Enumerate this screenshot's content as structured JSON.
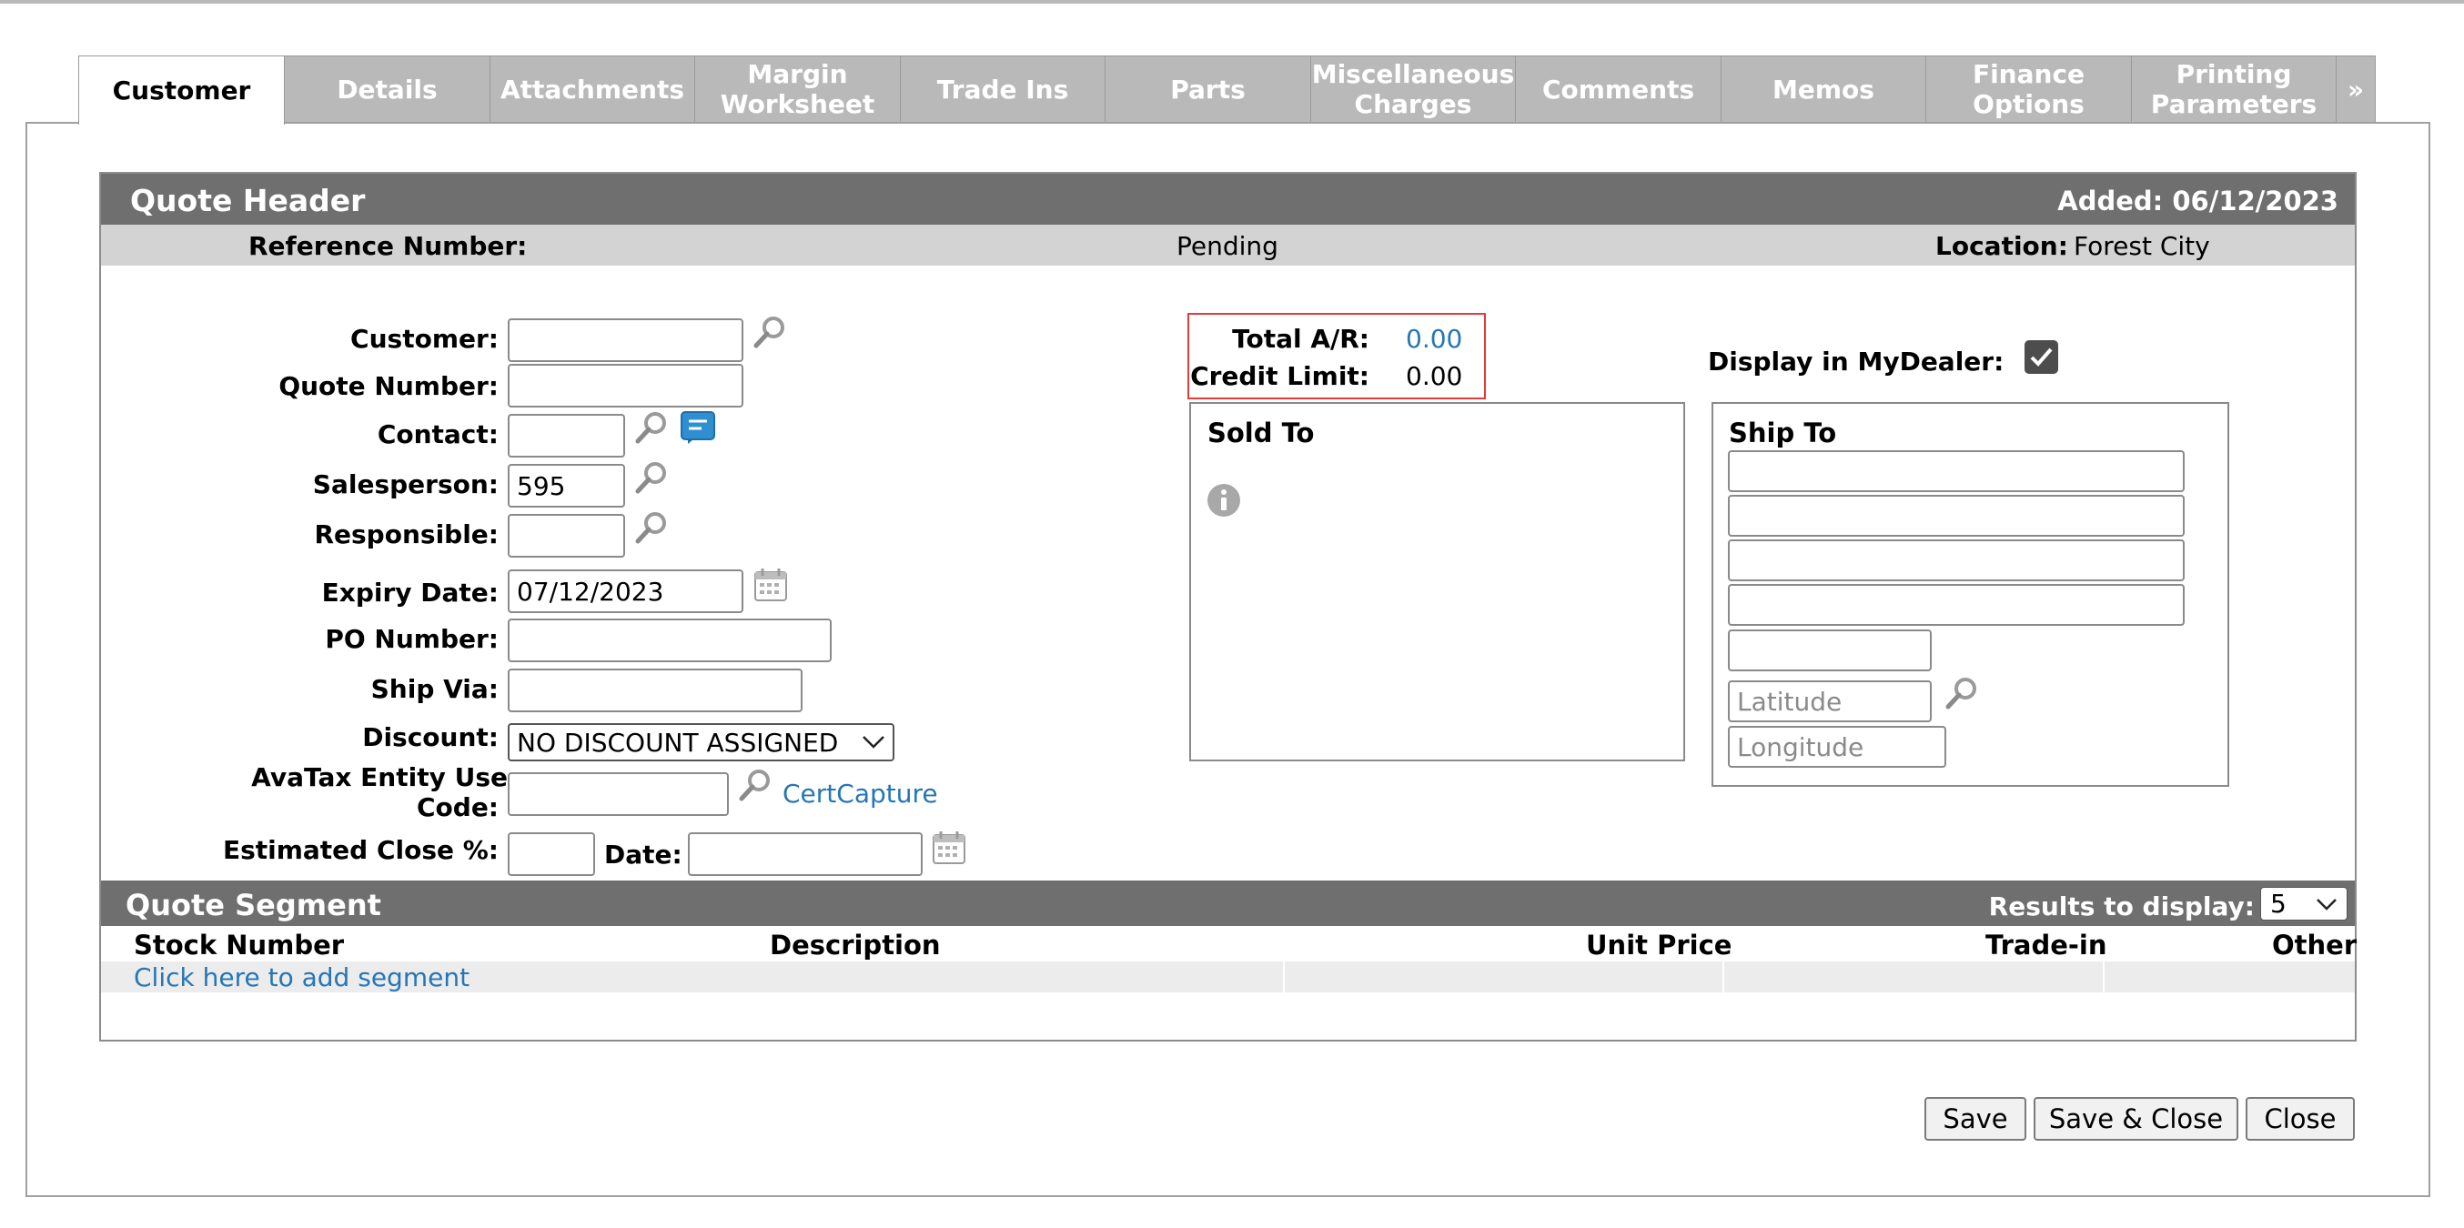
{
  "tabs": [
    {
      "label": "Customer",
      "active": true
    },
    {
      "label": "Details"
    },
    {
      "label": "Attachments"
    },
    {
      "label": "Margin\nWorksheet"
    },
    {
      "label": "Trade Ins"
    },
    {
      "label": "Parts"
    },
    {
      "label": "Miscellaneous\nCharges"
    },
    {
      "label": "Comments"
    },
    {
      "label": "Memos"
    },
    {
      "label": "Finance\nOptions"
    },
    {
      "label": "Printing\nParameters"
    },
    {
      "label": "»"
    }
  ],
  "quote_header": {
    "title": "Quote Header",
    "added": "Added: 06/12/2023",
    "reference_label": "Reference Number:",
    "status": "Pending",
    "location_label": "Location:",
    "location_value": "Forest City"
  },
  "form": {
    "customer_label": "Customer:",
    "customer_value": "",
    "quote_number_label": "Quote Number:",
    "quote_number_value": "",
    "contact_label": "Contact:",
    "contact_value": "",
    "salesperson_label": "Salesperson:",
    "salesperson_value": "595",
    "responsible_label": "Responsible:",
    "responsible_value": "",
    "expiry_label": "Expiry Date:",
    "expiry_value": "07/12/2023",
    "po_label": "PO Number:",
    "po_value": "",
    "ship_via_label": "Ship Via:",
    "ship_via_value": "",
    "discount_label": "Discount:",
    "discount_value": "NO DISCOUNT ASSIGNED",
    "avatax_label_1": "AvaTax Entity Use",
    "avatax_label_2": "Code:",
    "avatax_value": "",
    "certcapture": "CertCapture",
    "close_pct_label": "Estimated Close %:",
    "close_pct_value": "",
    "date_label": "Date:",
    "date_value": ""
  },
  "account": {
    "total_ar_label": "Total A/R:",
    "total_ar_value": "0.00",
    "credit_limit_label": "Credit Limit:",
    "credit_limit_value": "0.00"
  },
  "sold_to": {
    "title": "Sold To"
  },
  "mydealer": {
    "label": "Display in MyDealer:",
    "checked": true
  },
  "ship_to": {
    "title": "Ship To",
    "latitude_placeholder": "Latitude",
    "longitude_placeholder": "Longitude"
  },
  "segment": {
    "title": "Quote Segment",
    "results_label": "Results to display:",
    "results_value": "5",
    "columns": [
      "Stock Number",
      "Description",
      "Unit Price",
      "Trade-in",
      "Other"
    ],
    "add_link": "Click here to add segment"
  },
  "buttons": {
    "save": "Save",
    "save_close": "Save & Close",
    "close": "Close"
  },
  "colors": {
    "header_bg": "#6f6f6f",
    "tab_bg": "#b9b9b9",
    "link": "#2576b6",
    "highlight": "#e23b3b"
  }
}
